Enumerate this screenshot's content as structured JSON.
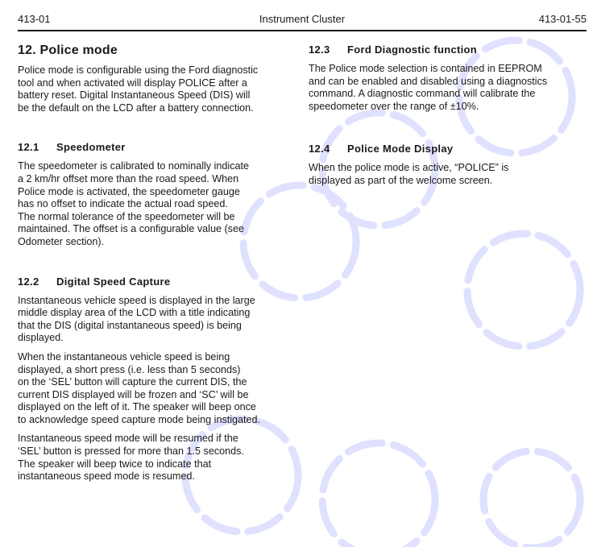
{
  "header": {
    "left": "413-01",
    "center": "Instrument Cluster",
    "right": "413-01-55"
  },
  "left_column": {
    "title": "12. Police mode",
    "intro": "Police mode is configurable using the Ford diagnostic\ntool and when activated will display POLICE after a\nbattery reset. Digital Instantaneous Speed (DIS) will\nbe the default on the LCD after a battery connection.",
    "sec_12_1": {
      "number": "12.1",
      "title": "Speedometer",
      "body": "The speedometer is calibrated to nominally indicate\na 2 km/hr offset more than the road speed.  When\nPolice mode is activated, the speedometer gauge\nhas no offset to indicate the actual road speed.\nThe normal tolerance of the speedometer will be\nmaintained. The offset is a configurable value (see\nOdometer section)."
    },
    "sec_12_2": {
      "number": "12.2",
      "title": "Digital Speed Capture",
      "p1": "Instantaneous vehicle speed is displayed in the large\nmiddle display area of the LCD with a title indicating\nthat the DIS (digital instantaneous speed) is being\ndisplayed.",
      "p2": "When the instantaneous vehicle speed is being\ndisplayed, a short press (i.e. less than 5 seconds)\non the ‘SEL’ button will capture the current DIS, the\ncurrent DIS displayed will be frozen and ‘SC’ will be\ndisplayed on the left of it. The speaker will beep once\nto acknowledge speed capture mode being instigated.",
      "p3": "Instantaneous speed mode will be resumed if the\n‘SEL’ button is pressed for more than 1.5 seconds.\nThe speaker will beep twice to indicate that\ninstantaneous speed mode is resumed."
    }
  },
  "right_column": {
    "sec_12_3": {
      "number": "12.3",
      "title": "Ford Diagnostic function",
      "body": "The Police mode selection is contained in EEPROM\nand can be enabled and disabled using a diagnostics\ncommand. A diagnostic command will calibrate the\nspeedometer over the range of ±10%."
    },
    "sec_12_4": {
      "number": "12.4",
      "title": "Police Mode Display",
      "body": "When the police mode is active, “POLICE” is\ndisplayed as part of the welcome screen."
    }
  },
  "colors": {
    "text": "#1a1a1a",
    "watermark": "#dfe1ff"
  }
}
